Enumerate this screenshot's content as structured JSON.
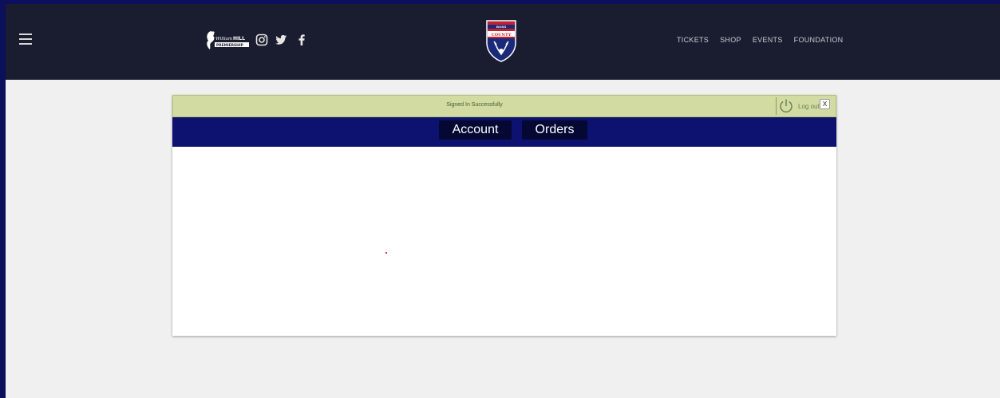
{
  "header": {
    "nav_items": [
      {
        "label": "TICKETS"
      },
      {
        "label": "SHOP"
      },
      {
        "label": "EVENTS"
      },
      {
        "label": "FOUNDATION"
      }
    ],
    "social": [
      "instagram-icon",
      "twitter-icon",
      "facebook-icon"
    ],
    "league_logo_text": "William HILL PREMIERSHIP",
    "crest_text": "ROSS COUNTY"
  },
  "alert": {
    "message": "Signed In Successfully",
    "logout_label": "Log out",
    "close_label": "X"
  },
  "tabs": [
    {
      "label": "Account"
    },
    {
      "label": "Orders"
    }
  ],
  "colors": {
    "page_border": "#0b0f5c",
    "header_bg": "#1a1d2f",
    "alert_bg": "#d2dca2",
    "tab_bar_bg": "#0d1170",
    "tab_bg": "#050833"
  }
}
